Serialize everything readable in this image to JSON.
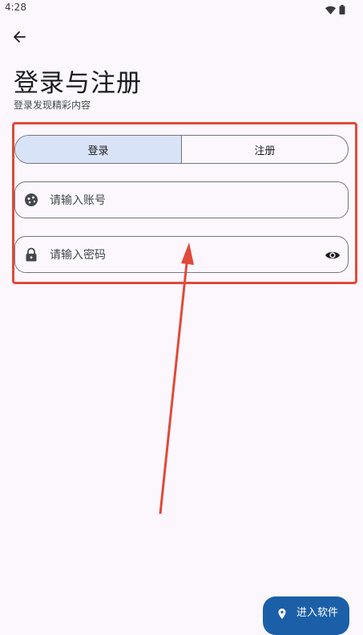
{
  "status_bar": {
    "time": "4:28",
    "wifi_icon": "wifi-icon",
    "battery_icon": "battery-icon"
  },
  "header": {
    "back_icon": "arrow-left-icon"
  },
  "page": {
    "title": "登录与注册",
    "subtitle": "登录发现精彩内容"
  },
  "tabs": [
    {
      "label": "登录",
      "selected": true
    },
    {
      "label": "注册",
      "selected": false
    }
  ],
  "account_field": {
    "placeholder": "请输入账号",
    "icon": "face-icon"
  },
  "password_field": {
    "placeholder": "请输入密码",
    "icon": "lock-icon",
    "toggle_icon": "eye-icon"
  },
  "fab": {
    "label": "进入软件",
    "icon": "pin-icon"
  },
  "colors": {
    "accent": "#1b5fa8",
    "selected_tab": "#d9e3f7",
    "annotation": "#e04a3b",
    "background": "#fbf7fd"
  }
}
